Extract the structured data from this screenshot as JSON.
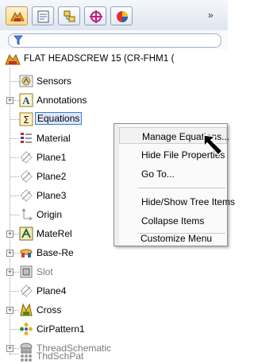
{
  "toolbar": {
    "overflow_label": "»",
    "tabs": [
      {
        "name": "featuremanager-tab",
        "icon": "featuremanager-icon"
      },
      {
        "name": "propertymanager-tab",
        "icon": "propertymanager-icon"
      },
      {
        "name": "configurationmanager-tab",
        "icon": "configurationmanager-icon"
      },
      {
        "name": "dimxpert-tab",
        "icon": "dimxpert-icon"
      },
      {
        "name": "display-manager-tab",
        "icon": "display-manager-icon"
      }
    ]
  },
  "filter": {
    "icon": "filter-icon"
  },
  "tree": {
    "root_label": "FLAT HEADSCREW 15 (CR-FHM1 (",
    "items": [
      {
        "label": "Sensors",
        "icon": "sensors-icon"
      },
      {
        "label": "Annotations",
        "icon": "annotations-icon"
      },
      {
        "label": "Equations",
        "icon": "equations-icon"
      },
      {
        "label": "Material",
        "icon": "material-icon"
      },
      {
        "label": "Plane1",
        "icon": "plane-icon"
      },
      {
        "label": "Plane2",
        "icon": "plane-icon"
      },
      {
        "label": "Plane3",
        "icon": "plane-icon"
      },
      {
        "label": "Origin",
        "icon": "origin-icon"
      },
      {
        "label": "MateRel",
        "icon": "materef-icon"
      },
      {
        "label": "Base-Re",
        "icon": "base-revolve-icon"
      },
      {
        "label": "Slot",
        "icon": "slot-icon"
      },
      {
        "label": "Plane4",
        "icon": "plane-icon"
      },
      {
        "label": "Cross",
        "icon": "cross-icon"
      },
      {
        "label": "CirPattern1",
        "icon": "circular-pattern-icon"
      },
      {
        "label": "ThreadSchematic",
        "icon": "thread-schematic-icon"
      },
      {
        "label": "ThdSchPat",
        "icon": "thread-pattern-icon"
      }
    ]
  },
  "context_menu": {
    "items": [
      {
        "label": "Manage Equations..."
      },
      {
        "label": "Hide File Properties"
      },
      {
        "label": "Go To..."
      },
      {
        "label": "Hide/Show Tree Items"
      },
      {
        "label": "Collapse Items"
      },
      {
        "label": "Customize Menu"
      }
    ]
  },
  "colors": {
    "selection": "#dbe8fb",
    "selection_border": "#3b7ad6",
    "toolbar_active": "#ffd98a"
  }
}
